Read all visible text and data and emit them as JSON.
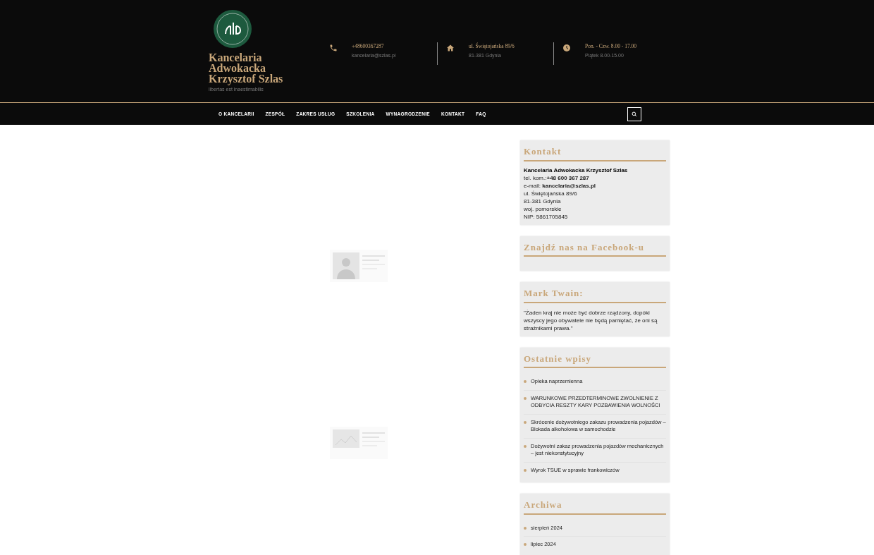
{
  "brand": {
    "title_lines": [
      "Kancelaria",
      "Adwokacka",
      "Krzysztof Szlas"
    ],
    "tagline": "libertas est inaestimabilis"
  },
  "contacts": [
    {
      "kind": "phone",
      "title": "+48600367287",
      "subtitle": "kancelaria@szlas.pl"
    },
    {
      "kind": "address",
      "title": "ul. Świętojańska 89/6",
      "subtitle": "81-381 Gdynia"
    },
    {
      "kind": "hours",
      "title": "Pon. - Czw. 8.00 - 17.00",
      "subtitle": "Piątek 8.00-15.00"
    }
  ],
  "nav": [
    {
      "label": "O KANCELARII"
    },
    {
      "label": "ZESPÓŁ"
    },
    {
      "label": "ZAKRES USŁUG"
    },
    {
      "label": "SZKOLENIA"
    },
    {
      "label": "WYNAGRODZENIE"
    },
    {
      "label": "KONTAKT"
    },
    {
      "label": "FAQ"
    }
  ],
  "post_previews": [
    {
      "kind": "portrait"
    },
    {
      "kind": "document"
    }
  ],
  "sidebar": [
    {
      "kind": "contact",
      "title": "Kontakt",
      "lines": [
        {
          "text": "Kancelaria Adwokacka Krzysztof Szlas",
          "bold": true
        },
        {
          "text": "tel. kom.:**+48 600 367 287**",
          "bold": false
        },
        {
          "text": "e-mail: **kancelaria@szlas.pl**",
          "bold": false
        },
        {
          "text": "ul. Świętojańska 89/6",
          "bold": false
        },
        {
          "text": "81-381 Gdynia",
          "bold": false
        },
        {
          "text": "woj. pomorskie",
          "bold": false
        },
        {
          "text": "NIP: 5861705845",
          "bold": false
        }
      ]
    },
    {
      "kind": "empty",
      "title": "Znajdź nas na Facebook-u"
    },
    {
      "kind": "quote",
      "title": "Mark Twain:",
      "text": "\"Żaden kraj nie może być dobrze rządzony, dopóki wszyscy jego obywatele nie będą pamiętać, że oni są strażnikami prawa.\""
    },
    {
      "kind": "list",
      "title": "Ostatnie wpisy",
      "items": [
        "Opieka naprzemienna",
        "WARUNKOWE PRZEDTERMINOWE ZWOLNIENIE Z ODBYCIA RESZTY KARY POZBAWIENIA WOLNOŚCI",
        "Skrócenie dożywotniego zakazu prowadzenia pojazdów – Blokada alkoholowa w samochodzie",
        "Dożywotni zakaz prowadzenia pojazdów mechanicznych – jest niekonstytucyjny",
        "Wyrok TSUE w sprawie frankowiczów"
      ]
    },
    {
      "kind": "list",
      "title": "Archiwa",
      "items": [
        "sierpień 2024",
        "lipiec 2024"
      ]
    }
  ]
}
